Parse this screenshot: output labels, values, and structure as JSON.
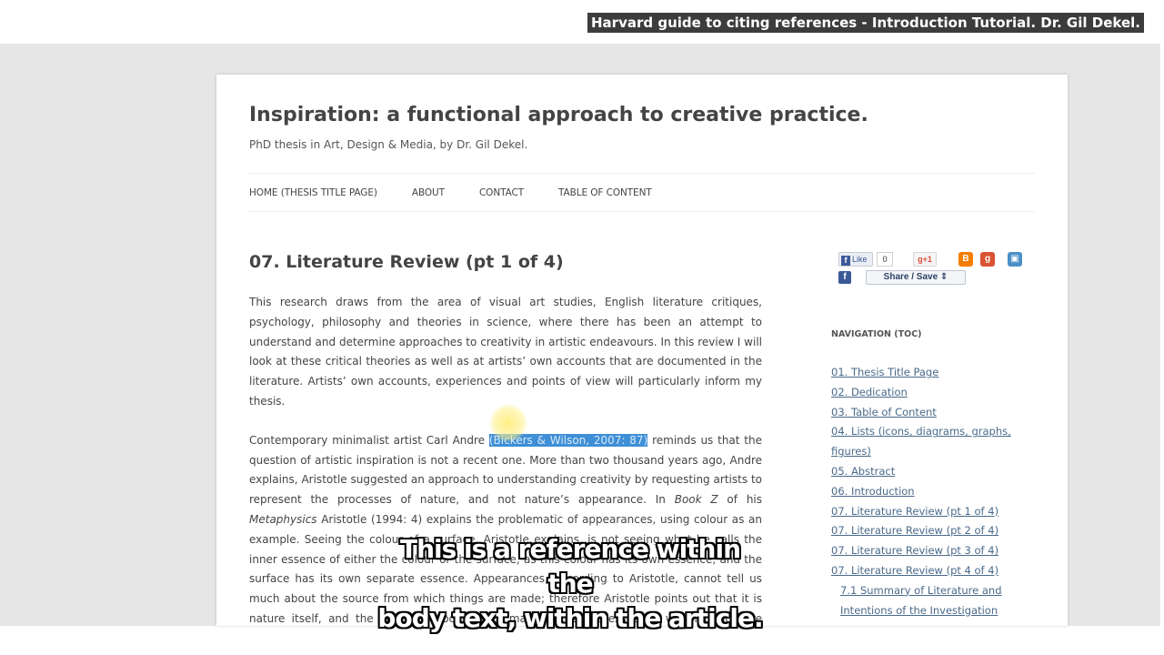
{
  "video_title": "Harvard guide to citing references - Introduction Tutorial.  Dr. Gil Dekel.",
  "site": {
    "title": "Inspiration: a functional approach to creative practice.",
    "description": "PhD thesis in Art, Design & Media, by Dr. Gil Dekel."
  },
  "nav": [
    {
      "label": "HOME (THESIS TITLE PAGE)"
    },
    {
      "label": "ABOUT"
    },
    {
      "label": "CONTACT"
    },
    {
      "label": "TABLE OF CONTENT"
    }
  ],
  "entry": {
    "title": "07. Literature Review (pt 1 of 4)",
    "para1": "This research draws from the area of visual art studies, English literature critiques, psychology, philosophy and theories in science, where there has been an attempt to understand and determine approaches to creativity in artistic endeavours. In this review I will look at these critical theories as well as at artists’ own accounts that are documented in the literature. Artists’ own accounts, experiences and points of view will particularly inform my thesis.",
    "para2_before": "Contemporary minimalist artist Carl Andre ",
    "para2_ref": "(Bickers & Wilson, 2007: 87)",
    "para2_mid1": " reminds us that the question of artistic inspiration is not a recent one. More than two thousand years ago, Andre explains, Aristotle suggested an approach to understanding creativity by requesting artists to represent the processes of nature, and not nature’s appearance. In ",
    "para2_em1": "Book Z",
    "para2_mid2": " of his ",
    "para2_em2": "Metaphysics",
    "para2_after": " Aristotle (1994: 4) explains the problematic of appearances, using colour as an example. Seeing the colour of a surface, Aristotle explains, is not seeing what he calls the inner essence of either the colour or the surface, as this colour has its own essence, and the surface has its own separate essence. Appearances, according to Aristotle, cannot tell us much about the source from which things are made; therefore Aristotle points out that it is nature itself, and the creative processes of making, the processes by which things are attached to other things."
  },
  "share": {
    "like_label": "Like",
    "like_count": "0",
    "gplus_label": "g+1",
    "share_label": "Share / Save ⇕"
  },
  "sidebar": {
    "heading": "NAVIGATION (TOC)",
    "toc": [
      {
        "label": "01. Thesis Title Page"
      },
      {
        "label": "02. Dedication"
      },
      {
        "label": "03. Table of Content"
      },
      {
        "label": "04. Lists (icons, diagrams, graphs, figures)"
      },
      {
        "label": "05. Abstract"
      },
      {
        "label": "06. Introduction"
      },
      {
        "label": "07. Literature Review (pt 1 of 4)"
      },
      {
        "label": "07. Literature Review (pt 2 of 4)"
      },
      {
        "label": "07. Literature Review (pt 3 of 4)"
      },
      {
        "label": "07. Literature Review (pt 4 of 4)"
      },
      {
        "label": "7.1 Summary of Literature and Intentions of the Investigation"
      }
    ]
  },
  "subtitle": {
    "line1": "This is a reference within the",
    "line2": "body text, within the article."
  },
  "colors": {
    "highlight": "#3f8fd6",
    "link": "#4a6a8a",
    "text": "#444444"
  }
}
